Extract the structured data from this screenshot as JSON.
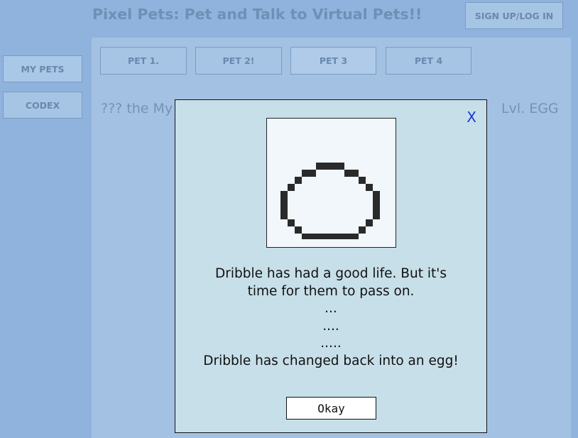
{
  "header": {
    "title": "Pixel Pets: Pet and Talk to Virtual Pets!!",
    "signup_label": "SIGN UP/LOG IN"
  },
  "sidebar": {
    "items": [
      {
        "label": "MY PETS"
      },
      {
        "label": "CODEX"
      }
    ]
  },
  "tabs": [
    {
      "label": "PET 1."
    },
    {
      "label": "PET 2!"
    },
    {
      "label": "PET 3"
    },
    {
      "label": "PET 4"
    }
  ],
  "pet": {
    "name_partial": "??? the My",
    "level": "Lvl. EGG"
  },
  "modal": {
    "close_label": "X",
    "image_icon": "egg-icon",
    "message_lines": [
      "Dribble has had a good life. But it's",
      "time for them to pass on.",
      "...",
      "....",
      ".....",
      "Dribble has changed back into an egg!"
    ],
    "okay_label": "Okay"
  },
  "colors": {
    "page_background": "#8fb3dd",
    "panel_background": "#a3c2e3",
    "modal_background": "#c7dfe9",
    "close_link": "#1a37d8",
    "egg_outline": "#2a2a2a"
  }
}
